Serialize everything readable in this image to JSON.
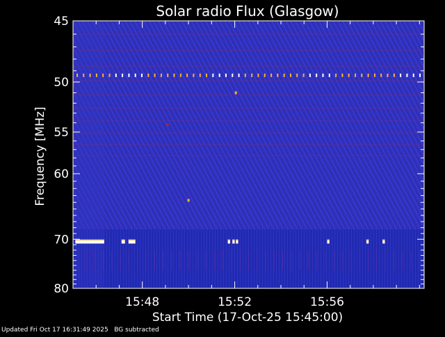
{
  "chart_data": {
    "type": "heatmap",
    "title": "Solar radio Flux (Glasgow)",
    "xlabel": "Start Time (17-Oct-25 15:45:00)",
    "ylabel": "Frequency [MHz]",
    "x_unit": "minutes after 15:45:00",
    "xlim": [
      0,
      15.2
    ],
    "ylim": [
      45,
      80
    ],
    "x_ticks": [
      {
        "label": "15:48",
        "value": 3
      },
      {
        "label": "15:52",
        "value": 7
      },
      {
        "label": "15:56",
        "value": 11
      }
    ],
    "y_ticks": [
      {
        "label": "45",
        "value": 45
      },
      {
        "label": "50",
        "value": 50
      },
      {
        "label": "55",
        "value": 55
      },
      {
        "label": "60",
        "value": 60
      },
      {
        "label": "70",
        "value": 70
      },
      {
        "label": "80",
        "value": 80
      }
    ],
    "y_scale": "log-like (decreasing spacing at higher frequency)",
    "colormap": [
      "#1e2bb0",
      "#3a3acf",
      "#c02020",
      "#ffb030",
      "#ffffff"
    ],
    "background_level_color": "#1e2bb0",
    "interference_lines": [
      {
        "freq_mhz": 49.4,
        "pattern": "periodic dotted yellow-white"
      },
      {
        "freq_mhz": 70.4,
        "pattern": "intermittent white bursts",
        "segments_min": [
          [
            0.1,
            1.35
          ],
          [
            2.1,
            2.25
          ],
          [
            2.4,
            2.7
          ],
          [
            6.7,
            6.8
          ],
          [
            6.9,
            7.0
          ],
          [
            7.05,
            7.15
          ],
          [
            11.0,
            11.1
          ],
          [
            12.7,
            12.8
          ],
          [
            13.4,
            13.5
          ]
        ]
      }
    ],
    "hotspots": [
      {
        "time_min": 7.05,
        "freq_mhz": 51.0,
        "color": "#ffb030"
      },
      {
        "time_min": 5.0,
        "freq_mhz": 63.7,
        "color": "#ffb030"
      },
      {
        "time_min": 4.1,
        "freq_mhz": 54.2,
        "color": "#c02020"
      }
    ]
  },
  "footer": {
    "updated": "Updated Fri Oct 17 16:31:49 2025",
    "note": "BG subtracted"
  }
}
